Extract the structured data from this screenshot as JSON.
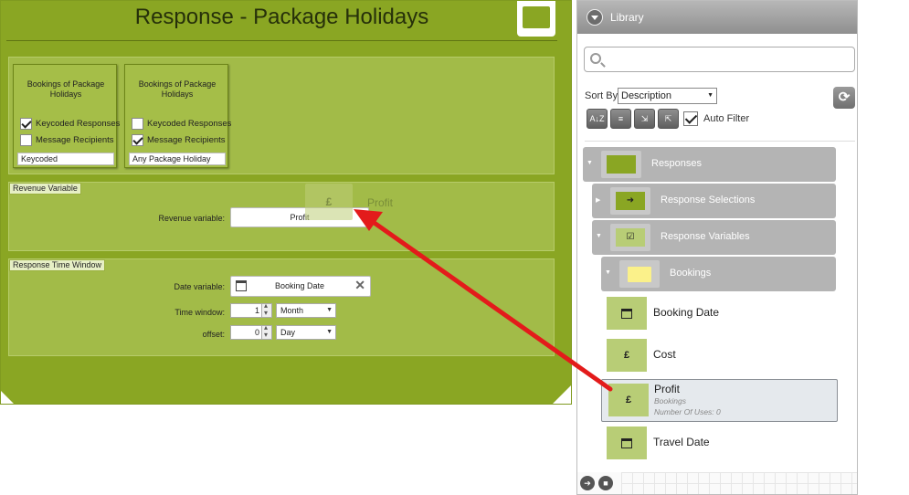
{
  "response_panel": {
    "title": "Response - Package Holidays",
    "boxes": [
      {
        "title": "Bookings of Package Holidays",
        "option1": "Keycoded Responses",
        "option1_checked": true,
        "option2": "Message Recipients",
        "option2_checked": false,
        "field": "Keycoded"
      },
      {
        "title": "Bookings of Package Holidays",
        "option1": "Keycoded Responses",
        "option1_checked": false,
        "option2": "Message Recipients",
        "option2_checked": true,
        "field": "Any Package Holiday"
      }
    ],
    "revenue": {
      "section_label": "Revenue Variable",
      "label": "Revenue variable:",
      "value": "Profit",
      "ghost_icon": "£",
      "ghost_label": "Profit"
    },
    "time_window": {
      "section_label": "Response Time Window",
      "date_label": "Date variable:",
      "date_value": "Booking Date",
      "window_label": "Time window:",
      "window_number": "1",
      "window_unit": "Month",
      "offset_label": "offset:",
      "offset_number": "0",
      "offset_unit": "Day"
    }
  },
  "library": {
    "title": "Library",
    "search_placeholder": "",
    "sort_label": "Sort By",
    "sort_value": "Description",
    "tool_buttons": [
      "A↓Z",
      "≡",
      "⇲",
      "⇱"
    ],
    "refresh_glyph": "⟳",
    "auto_filter_label": "Auto Filter",
    "tree": {
      "responses": "Responses",
      "response_selections": "Response Selections",
      "response_variables": "Response Variables",
      "bookings": "Bookings"
    },
    "items": [
      {
        "label": "Booking Date",
        "icon": "calendar-icon"
      },
      {
        "label": "Cost",
        "icon": "pound-icon",
        "glyph": "£"
      },
      {
        "label": "Profit",
        "icon": "pound-icon",
        "glyph": "£",
        "folder": "Bookings",
        "uses": "Number Of Uses: 0"
      },
      {
        "label": "Travel Date",
        "icon": "calendar-icon"
      }
    ]
  },
  "colors": {
    "accent": "#8aa623",
    "drag_arrow": "#e31b1b"
  }
}
